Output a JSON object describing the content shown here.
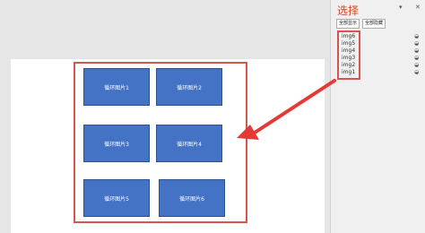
{
  "canvas": {
    "pictures": [
      {
        "label": "循环图片1"
      },
      {
        "label": "循环图片2"
      },
      {
        "label": "循环图片3"
      },
      {
        "label": "循环图片4"
      },
      {
        "label": "循环图片5"
      },
      {
        "label": "循环图片6"
      }
    ]
  },
  "selection_pane": {
    "title": "选择",
    "show_all_label": "全部显示",
    "hide_all_label": "全部隐藏",
    "items": [
      "img6",
      "img5",
      "img4",
      "img3",
      "img2",
      "img1"
    ]
  },
  "colors": {
    "picture_fill": "#4472c4",
    "highlight": "#d9534f",
    "title": "#d24726"
  },
  "icons": [
    "dropdown-icon",
    "close-icon",
    "eye-icon",
    "arrow-annotation-icon"
  ]
}
